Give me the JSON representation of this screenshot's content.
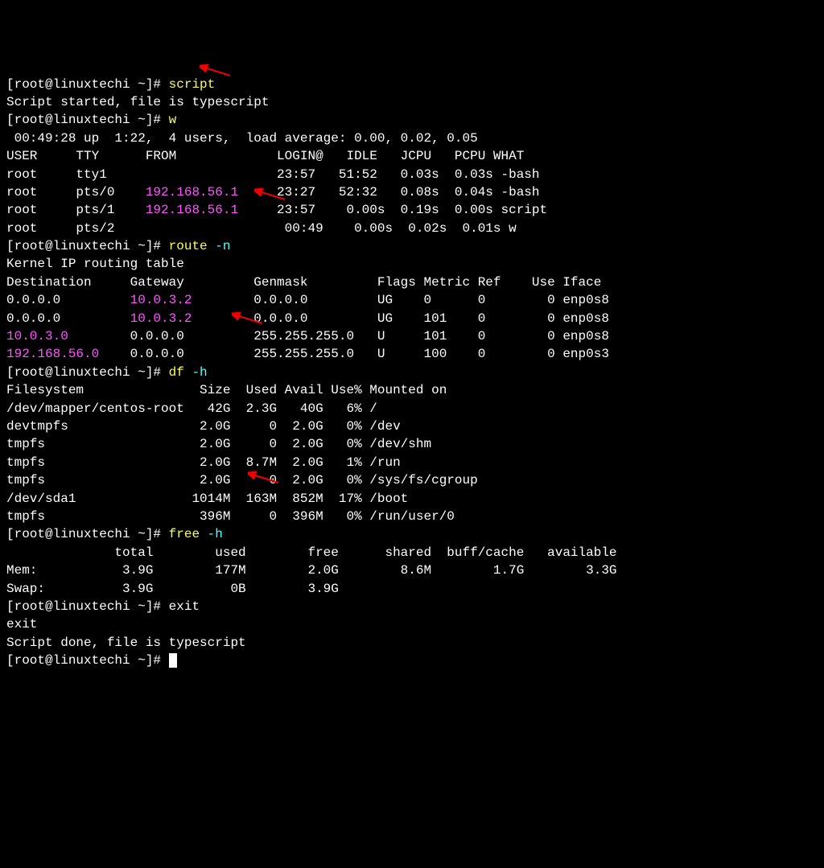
{
  "prompt": "[root@linuxtechi ~]# ",
  "cmd1": "script",
  "line_script_started": "Script started, file is typescript",
  "cmd2": "w",
  "uptime": " 00:49:28 up  1:22,  4 users,  load average: 0.00, 0.02, 0.05",
  "w_header": "USER     TTY      FROM             LOGIN@   IDLE   JCPU   PCPU WHAT",
  "w_rows": [
    {
      "pre": "root     tty1                      23:57   51:52   0.03s  0.03s -bash"
    },
    {
      "a": "root     pts/0    ",
      "ip": "192.168.56.1",
      "b": "     23:27   52:32   0.08s  0.04s -bash"
    },
    {
      "a": "root     pts/1    ",
      "ip": "192.168.56.1",
      "b": "     23:57    0.00s  0.19s  0.00s script"
    },
    {
      "pre": "root     pts/2                      00:49    0.00s  0.02s  0.01s w"
    }
  ],
  "cmd3a": "route ",
  "cmd3b": "-n",
  "route_title": "Kernel IP routing table",
  "route_header": "Destination     Gateway         Genmask         Flags Metric Ref    Use Iface",
  "route_rows": [
    {
      "a": "0.0.0.0         ",
      "g": "10.0.3.2",
      "b": "        0.0.0.0         UG    0      0        0 enp0s8"
    },
    {
      "a": "0.0.0.0         ",
      "g": "10.0.3.2",
      "b": "        0.0.0.0         UG    101    0        0 enp0s8"
    },
    {
      "d": "10.0.3.0",
      "b": "        0.0.0.0         255.255.255.0   U     101    0        0 enp0s8"
    },
    {
      "d": "192.168.56.0",
      "b": "    0.0.0.0         255.255.255.0   U     100    0        0 enp0s3"
    }
  ],
  "cmd4a": "df ",
  "cmd4b": "-h",
  "df_header": "Filesystem               Size  Used Avail Use% Mounted on",
  "df_rows": [
    "/dev/mapper/centos-root   42G  2.3G   40G   6% /",
    "devtmpfs                 2.0G     0  2.0G   0% /dev",
    "tmpfs                    2.0G     0  2.0G   0% /dev/shm",
    "tmpfs                    2.0G  8.7M  2.0G   1% /run",
    "tmpfs                    2.0G     0  2.0G   0% /sys/fs/cgroup",
    "/dev/sda1               1014M  163M  852M  17% /boot",
    "tmpfs                    396M     0  396M   0% /run/user/0"
  ],
  "cmd5a": "free ",
  "cmd5b": "-h",
  "free_header": "              total        used        free      shared  buff/cache   available",
  "free_rows": [
    "Mem:           3.9G        177M        2.0G        8.6M        1.7G        3.3G",
    "Swap:          3.9G          0B        3.9G"
  ],
  "cmd6": "exit",
  "exit_echo": "exit",
  "script_done": "Script done, file is typescript"
}
